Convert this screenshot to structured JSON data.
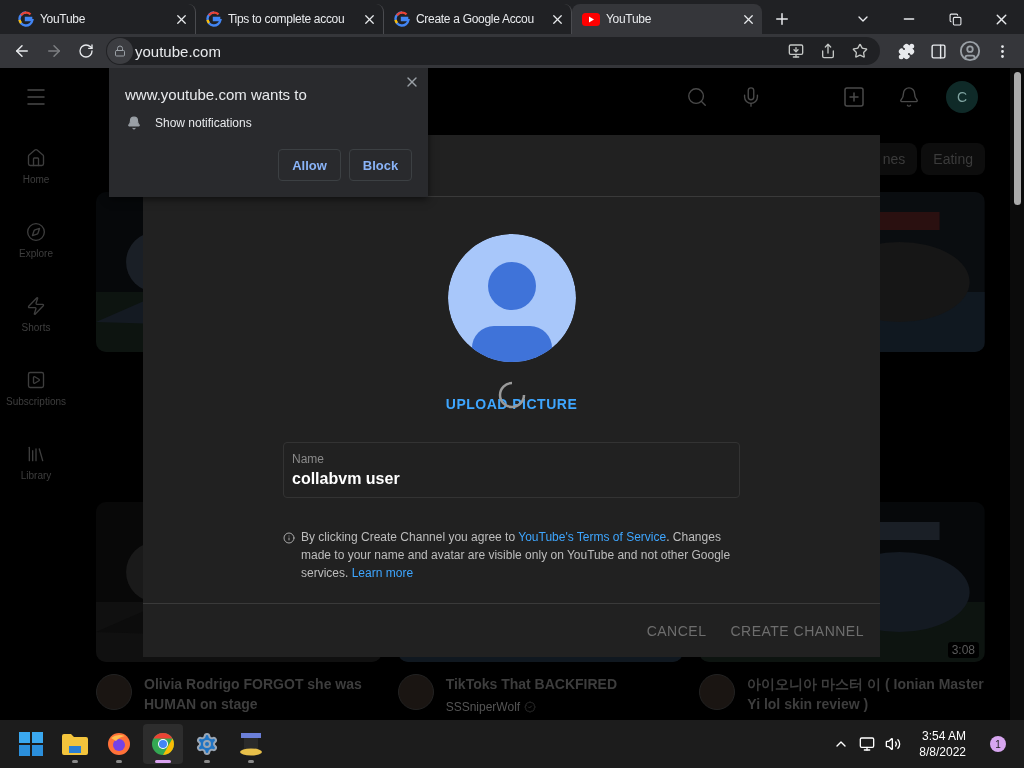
{
  "browser": {
    "tabs": [
      {
        "title": "YouTube",
        "kind": "google",
        "selected": false
      },
      {
        "title": "Tips to complete accou",
        "kind": "google",
        "selected": false
      },
      {
        "title": "Create a Google Accou",
        "kind": "google",
        "selected": false
      },
      {
        "title": "YouTube",
        "kind": "youtube",
        "selected": true
      }
    ],
    "url": "youtube.com",
    "forward_disabled": true
  },
  "youtube": {
    "account_initial": "C",
    "guide": [
      {
        "label": "Home",
        "kind": "home"
      },
      {
        "label": "Explore",
        "kind": "explore"
      },
      {
        "label": "Shorts",
        "kind": "shorts"
      },
      {
        "label": "Subscriptions",
        "kind": "subscriptions"
      },
      {
        "label": "Library",
        "kind": "library"
      }
    ],
    "chips": [
      "nes",
      "Eating"
    ],
    "videos": [
      {
        "title": "Olivia Rodrigo FORGOT she was HUMAN on stage"
      },
      {
        "title": "TikToks That BACKFIRED",
        "channel": "SSSniperWolf",
        "verified": true
      },
      {
        "title": "아이오니아 마스터 이 ( Ionian Master Yi lol skin review )",
        "duration": "3:08"
      }
    ]
  },
  "dialog": {
    "upload_label": "UPLOAD PICTURE",
    "uploading": true,
    "name_label": "Name",
    "name_value": "collabvm user",
    "disclaimer": {
      "before": "By clicking Create Channel you agree to ",
      "terms_link": "YouTube's Terms of Service",
      "middle": ". Changes made to your name and avatar are visible only on YouTube and not other Google services. ",
      "learn_more": "Learn more"
    },
    "buttons": {
      "cancel": "CANCEL",
      "create": "CREATE CHANNEL"
    }
  },
  "permission_popup": {
    "title": "www.youtube.com wants to",
    "permission": "Show notifications",
    "buttons": [
      "Allow",
      "Block"
    ]
  },
  "taskbar": {
    "apps": [
      {
        "kind": "start",
        "active": false,
        "running": false
      },
      {
        "kind": "files",
        "active": false,
        "running": true
      },
      {
        "kind": "firefox",
        "active": false,
        "running": true
      },
      {
        "kind": "chrome",
        "active": true,
        "running": true
      },
      {
        "kind": "settings",
        "active": false,
        "running": true
      },
      {
        "kind": "app",
        "active": false,
        "running": true
      }
    ],
    "time": "3:54 AM",
    "date": "8/8/2022",
    "notifications": "1"
  }
}
